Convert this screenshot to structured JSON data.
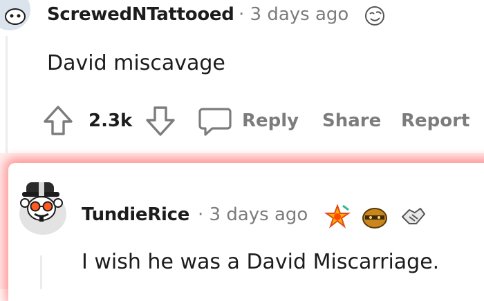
{
  "comment1": {
    "username": "ScrewedNTattooed",
    "separator": "·",
    "time": "3 days ago",
    "badge_icon": "smiley-face-award-icon",
    "body": "David miscavage"
  },
  "actions": {
    "upvote_icon": "upvote-arrow-icon",
    "score": "2.3k",
    "downvote_icon": "downvote-arrow-icon",
    "reply_icon": "speech-bubble-icon",
    "reply_label": "Reply",
    "share_label": "Share",
    "report_label": "Report"
  },
  "comment2": {
    "username": "TundieRice",
    "separator": "·",
    "time": "3 days ago",
    "badge_icons": [
      "starstruck-award-icon",
      "helmet-award-icon",
      "handshake-award-icon"
    ],
    "body": "I wish he was a David Miscarriage."
  },
  "colors": {
    "text": "#1c1c1c",
    "meta": "#7c7c7c",
    "highlight": "#ff3c3c"
  }
}
